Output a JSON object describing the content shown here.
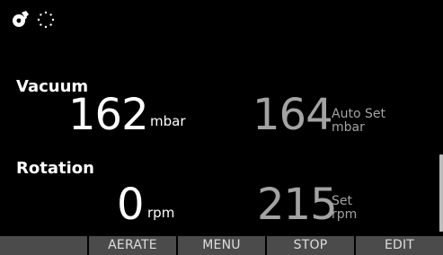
{
  "status": {
    "icons": [
      "wrench-gear-icon",
      "busy-spinner-icon"
    ]
  },
  "vacuum": {
    "label": "Vacuum",
    "actual_value": "162",
    "actual_unit": "mbar",
    "set_value": "164",
    "set_mode": "Auto Set",
    "set_unit": "mbar"
  },
  "rotation": {
    "label": "Rotation",
    "actual_value": "0",
    "actual_unit": "rpm",
    "set_value": "215",
    "set_mode": "Set",
    "set_unit": "rpm"
  },
  "softkeys": [
    "",
    "AERATE",
    "MENU",
    "STOP",
    "EDIT"
  ],
  "colors": {
    "background": "#000000",
    "actual_text": "#ffffff",
    "setpoint_text": "#a3a3a3",
    "softkey_bg": "#4b4b4b"
  }
}
